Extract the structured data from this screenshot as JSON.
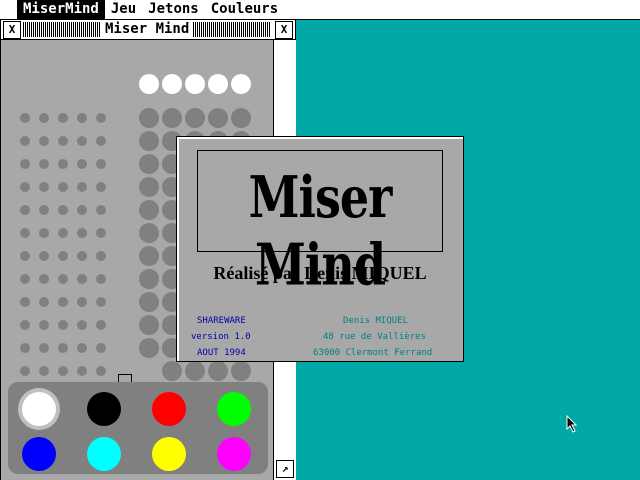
{
  "menubar": {
    "items": [
      {
        "label": "MiserMind",
        "active": true
      },
      {
        "label": "Jeu",
        "active": false
      },
      {
        "label": "Jetons",
        "active": false
      },
      {
        "label": "Couleurs",
        "active": false
      }
    ]
  },
  "window": {
    "title": "Miser Mind",
    "close_glyph": "X",
    "full_glyph": "X",
    "sizer_glyph": "↗"
  },
  "board": {
    "rows": 12,
    "secret_pegs": 5,
    "secret_color": "#ffffff",
    "hole_color": "#808080"
  },
  "palette": {
    "colors": [
      "#ffffff",
      "#000000",
      "#ff0000",
      "#00ff00",
      "#0000ff",
      "#00ffff",
      "#ffff00",
      "#ff00ff"
    ],
    "icon": "color-peg-icon"
  },
  "dialog": {
    "logo": "Miser Mind",
    "credit": "Réalisé par Denis MIQUEL",
    "left_lines": [
      "SHAREWARE",
      "version 1.0",
      "AOUT 1994"
    ],
    "right_lines": [
      "Denis MIQUEL",
      "48 rue de Vallières",
      "63000 Clermont Ferrand"
    ]
  },
  "colors": {
    "desktop": "#00a8a8",
    "window": "#a8a8a8",
    "blue_text": "#0000a8",
    "teal_text": "#008080"
  }
}
